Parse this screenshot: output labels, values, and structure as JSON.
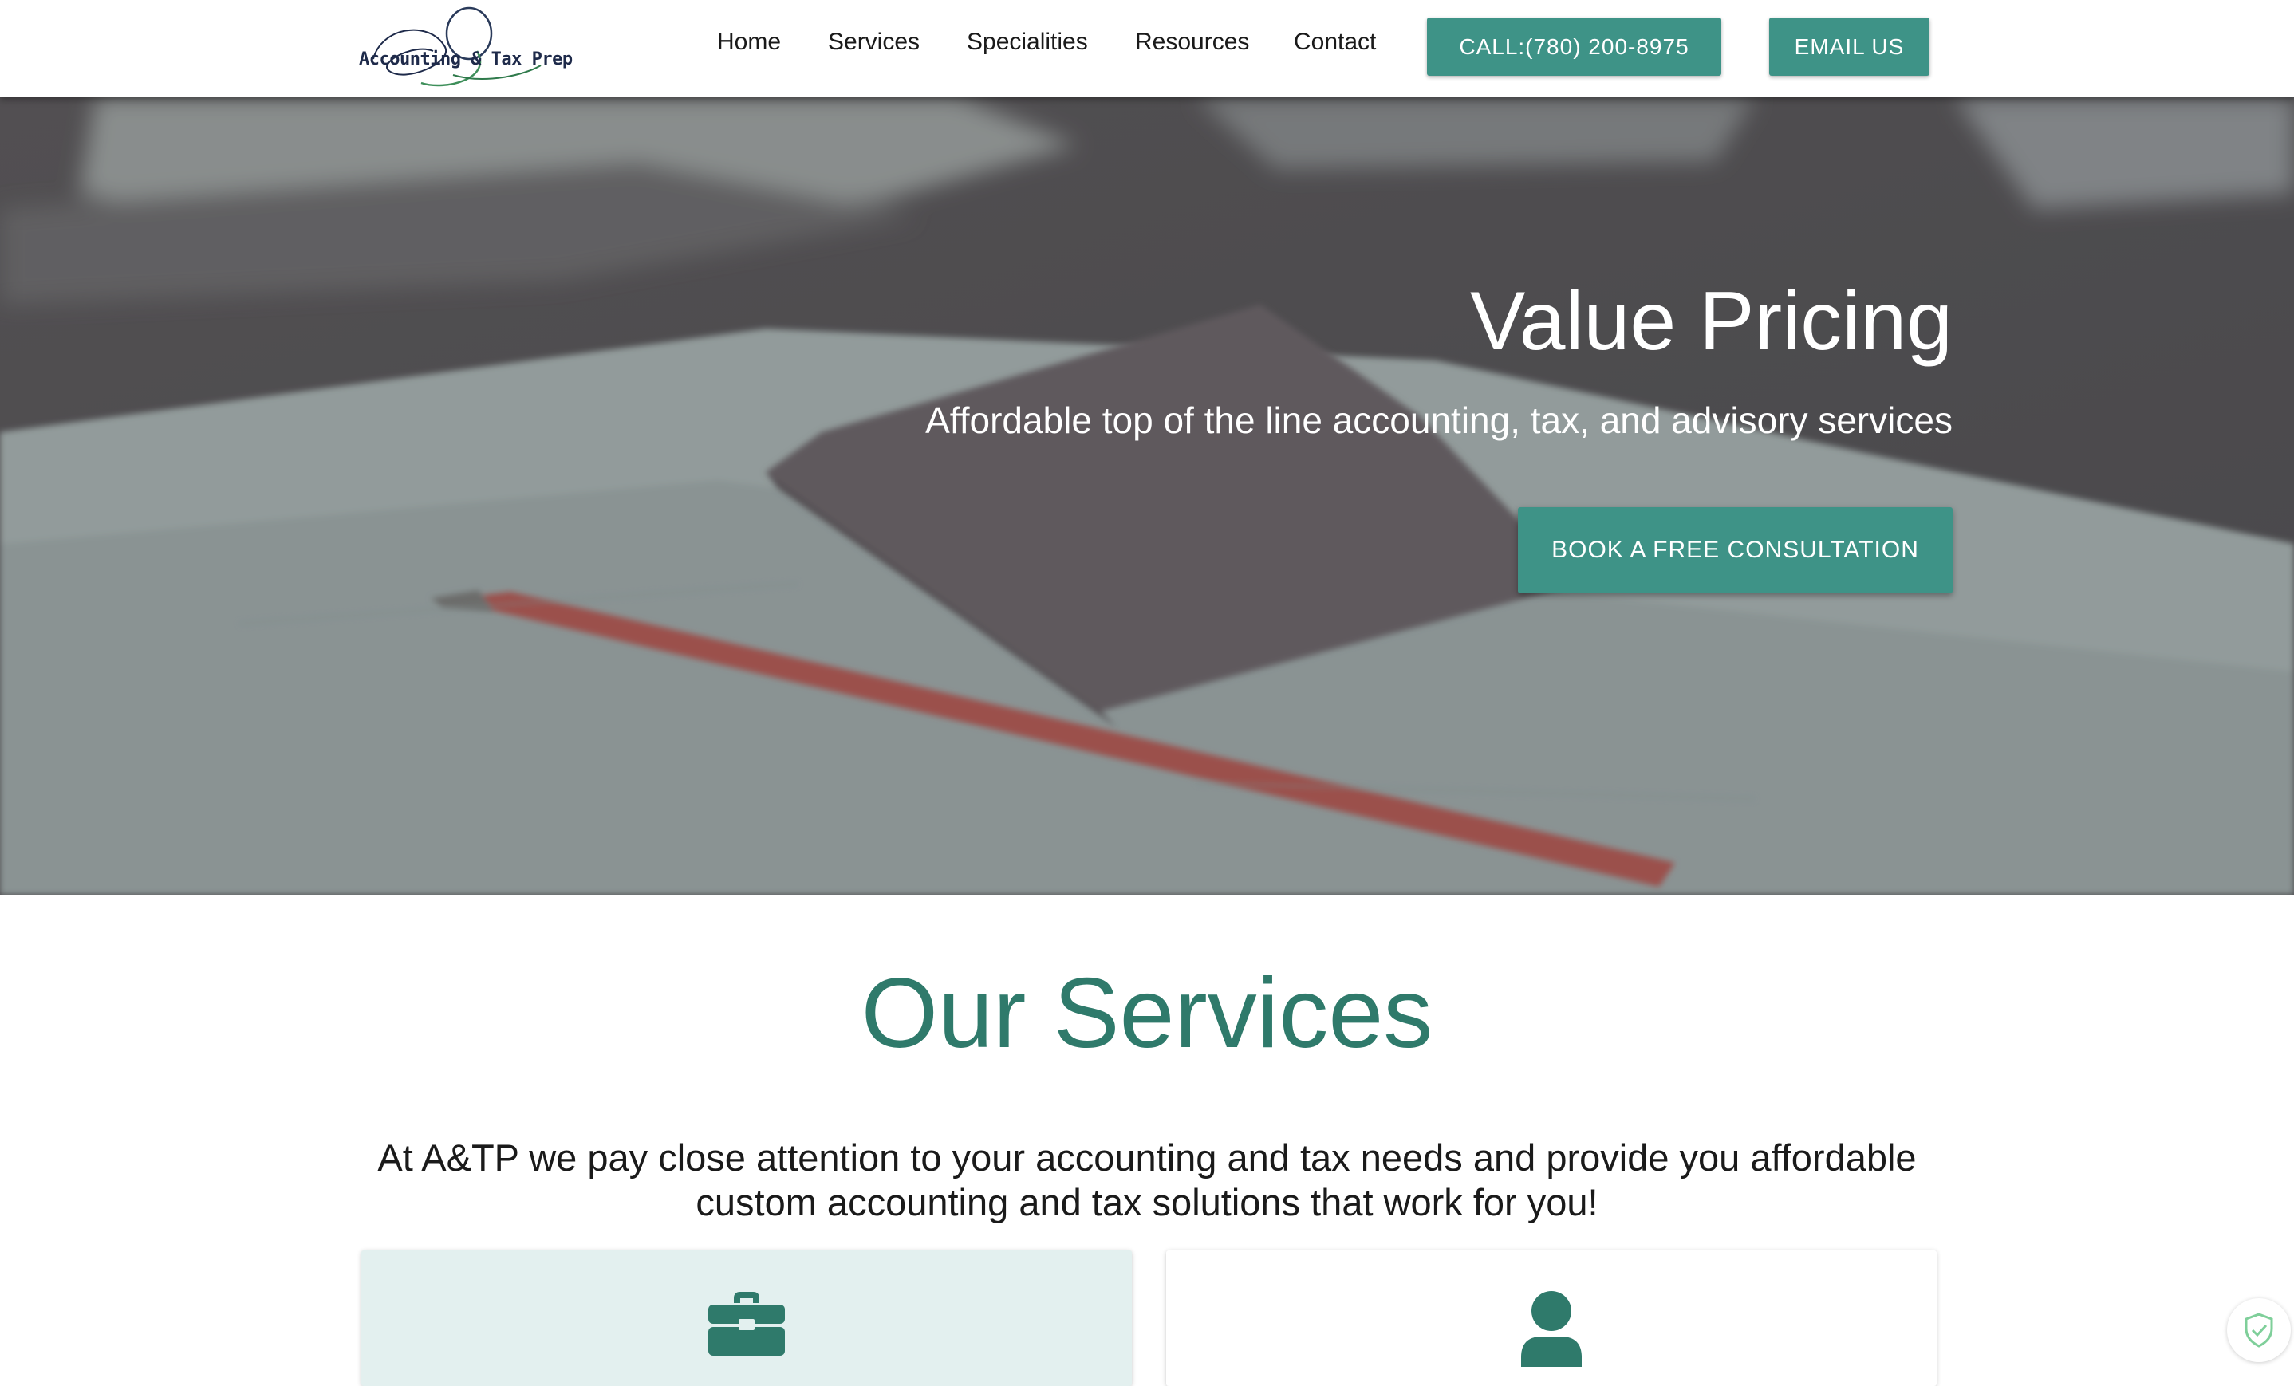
{
  "header": {
    "logo_text": "Accounting & Tax Prep",
    "nav": [
      {
        "label": "Home"
      },
      {
        "label": "Services"
      },
      {
        "label": "Specialities"
      },
      {
        "label": "Resources"
      },
      {
        "label": "Contact"
      }
    ],
    "call_button": "CALL:(780) 200-8975",
    "email_button": "EMAIL US"
  },
  "hero": {
    "title": "Value Pricing",
    "subtitle": "Affordable top of the line accounting, tax, and advisory services",
    "cta_button": "BOOK A FREE CONSULTATION"
  },
  "services": {
    "title": "Our Services",
    "intro": "At A&TP we pay close attention to your accounting and tax needs and provide you affordable custom accounting and tax solutions that work for you!",
    "cards": [
      {
        "icon": "briefcase-icon"
      },
      {
        "icon": "user-icon"
      }
    ]
  },
  "colors": {
    "accent": "#3e9387",
    "heading": "#2f7a6b",
    "card_tint": "#e3f0ef",
    "text": "#1a1a1a"
  },
  "badge": {
    "icon": "shield-check-icon"
  }
}
